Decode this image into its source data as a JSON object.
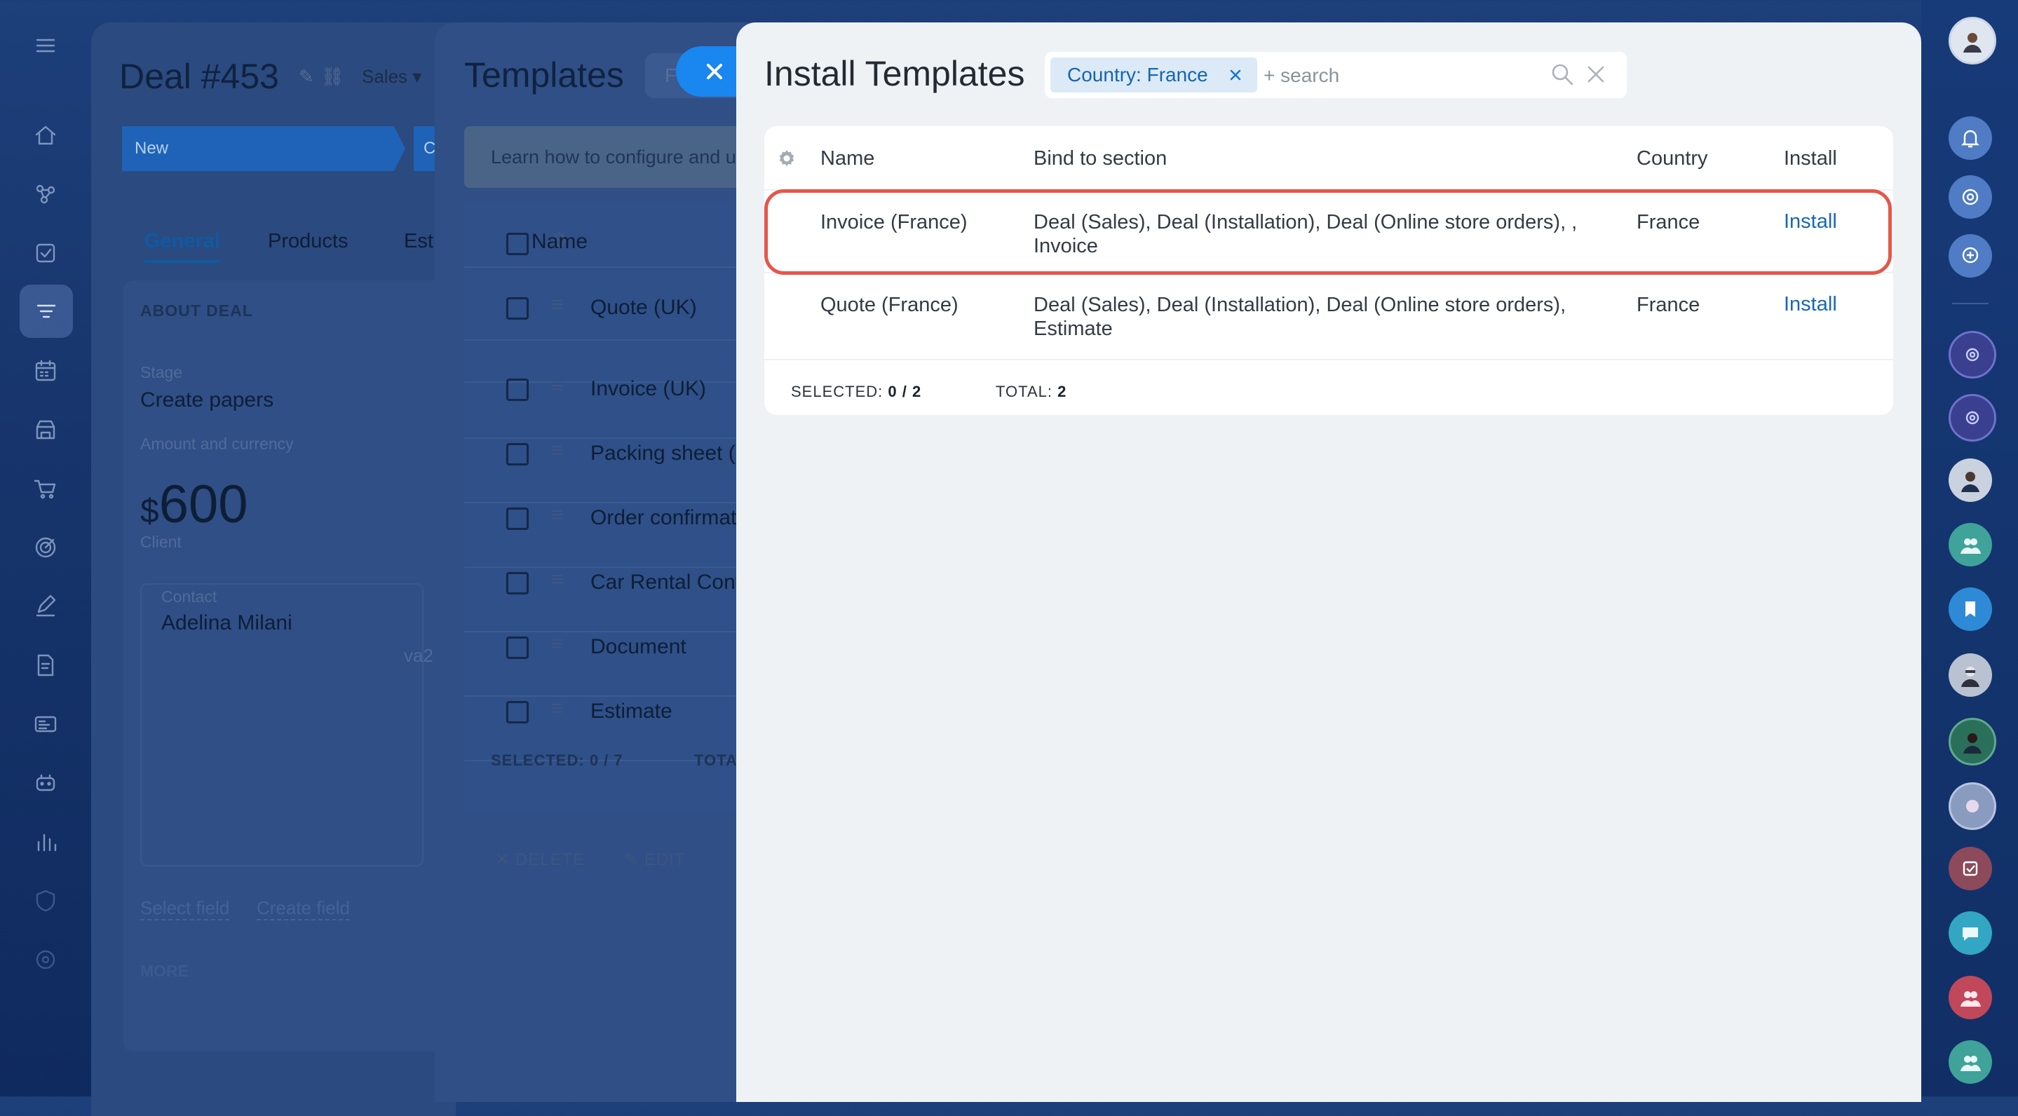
{
  "colors": {
    "accent": "#1768b4",
    "highlight": "#e5564a",
    "close_button": "#1a86f0",
    "chip_bg": "#dbeaf6"
  },
  "deal": {
    "title": "Deal #453",
    "pipeline": "Sales",
    "stage_current": "New",
    "stage_next": "C",
    "tabs": [
      "General",
      "Products",
      "Est"
    ],
    "section_title": "ABOUT DEAL",
    "stage_label": "Stage",
    "stage_value": "Create papers",
    "amount_label": "Amount and currency",
    "currency": "$",
    "amount": "600",
    "client_label": "Client",
    "contact_label": "Contact",
    "contact_name": "Adelina Milani",
    "contact_extra": "va2",
    "link_select": "Select field",
    "link_create": "Create field",
    "more_label": "MORE"
  },
  "templates": {
    "title": "Templates",
    "filter_stub": "F",
    "banner": "Learn how to configure and u",
    "name_header": "Name",
    "items": [
      "Quote (UK)",
      "Invoice (UK)",
      "Packing sheet (U",
      "Order confirmat",
      "Car Rental Cont",
      "Document",
      "Estimate"
    ],
    "selected_label": "SELECTED:",
    "selected_value": "0 / 7",
    "total_label": "TOTA",
    "delete_label": "DELETE",
    "edit_label": "EDIT"
  },
  "install": {
    "title": "Install Templates",
    "filter_chip": "Country: France",
    "search_placeholder": "+ search",
    "columns": {
      "name": "Name",
      "bind": "Bind to section",
      "country": "Country",
      "install": "Install"
    },
    "rows": [
      {
        "name": "Invoice (France)",
        "bind_line1": "Deal (Sales), Deal (Installation), Deal (Online store orders), ,",
        "bind_line2": "Invoice",
        "country": "France",
        "action": "Install"
      },
      {
        "name": "Quote (France)",
        "bind_line1": "Deal (Sales), Deal (Installation), Deal (Online store orders),",
        "bind_line2": "Estimate",
        "country": "France",
        "action": "Install"
      }
    ],
    "selected_label": "SELECTED:",
    "selected_value": "0 / 2",
    "total_label": "TOTAL:",
    "total_value": "2"
  },
  "icons": {
    "left": [
      "menu-icon",
      "home-icon",
      "crm-icon",
      "tasks-icon",
      "filter-icon",
      "calendar-icon",
      "store-icon",
      "cart-icon",
      "target-icon",
      "sign-icon",
      "document-icon",
      "contact-center-icon",
      "automation-icon",
      "analytics-icon",
      "security-icon",
      "settings-icon"
    ],
    "right": [
      "avatar",
      "bell-icon",
      "copilot-icon",
      "search-chat-icon",
      "channel-icon",
      "channel-icon",
      "user-avatar",
      "group-icon",
      "bookmark-icon",
      "user-avatar",
      "user-avatar",
      "group-avatar",
      "task-icon",
      "chat-icon",
      "group-icon",
      "group-icon"
    ]
  }
}
